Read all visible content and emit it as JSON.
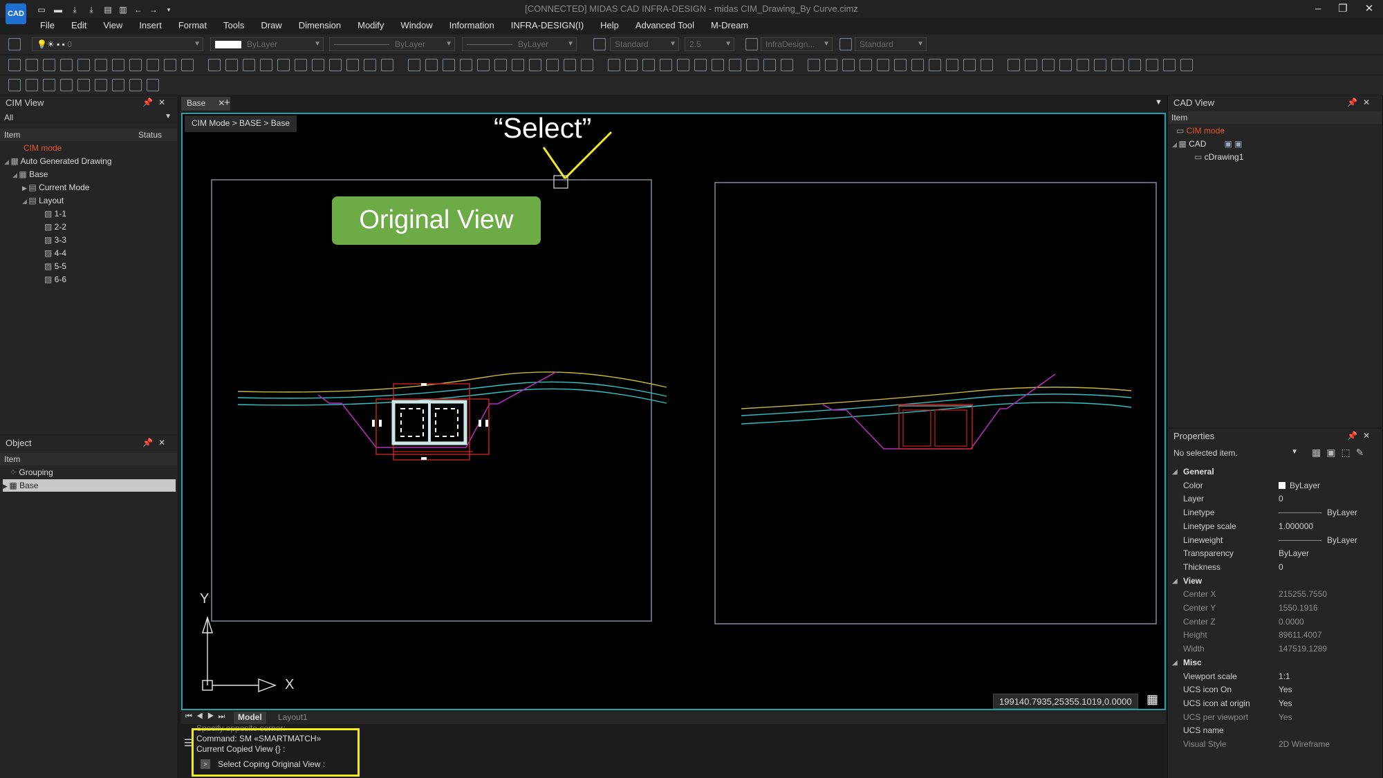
{
  "window": {
    "title": "[CONNECTED] MIDAS CAD INFRA-DESIGN - midas CIM_Drawing_By Curve.cimz",
    "logo": "CAD"
  },
  "menu": [
    "File",
    "Edit",
    "View",
    "Insert",
    "Format",
    "Tools",
    "Draw",
    "Dimension",
    "Modify",
    "Window",
    "Information",
    "INFRA-DESIGN(I)",
    "Help",
    "Advanced Tool",
    "M-Dream"
  ],
  "props_bar": {
    "layer": "0",
    "color": "ByLayer",
    "linetype": "ByLayer",
    "lineweight": "ByLayer",
    "text_style": "Standard",
    "text_height": "2.5",
    "dim_style": "InfraDesign...",
    "table_style": "Standard"
  },
  "cim_view": {
    "title": "CIM View",
    "filter": "All",
    "col_item": "Item",
    "col_status": "Status",
    "rows": [
      "CIM mode",
      "Auto Generated Drawing",
      "Base",
      "Current Mode",
      "Layout",
      "1-1",
      "2-2",
      "3-3",
      "4-4",
      "5-5",
      "6-6"
    ]
  },
  "object_panel": {
    "title": "Object",
    "col_item": "Item",
    "rows": [
      "Grouping",
      "Base"
    ]
  },
  "doc_tab": {
    "label": "Base",
    "plus": "+"
  },
  "breadcrumb": "CIM Mode > BASE > Base",
  "annotation": {
    "select_label": "“Select”",
    "original_view": "Original View"
  },
  "ucs": {
    "y": "Y",
    "x": "X"
  },
  "coords": "199140.7935,25355.1019,0.0000",
  "layout_tabs": [
    "Model",
    "Layout1"
  ],
  "command": {
    "line0": "Specify opposite corner:",
    "line1": "Command:  SM «SMARTMATCH»",
    "line2": "Current Copied View {} :",
    "prompt": "Select Coping Original View :"
  },
  "cad_view": {
    "title": "CAD View",
    "col_item": "Item",
    "rows": [
      "CIM mode",
      "CAD",
      "cDrawing1"
    ]
  },
  "properties": {
    "title": "Properties",
    "selection": "No selected item.",
    "groups": {
      "general": "General",
      "view": "View",
      "misc": "Misc"
    },
    "general": [
      {
        "k": "Color",
        "v": "ByLayer"
      },
      {
        "k": "Layer",
        "v": "0"
      },
      {
        "k": "Linetype",
        "v": "ByLayer"
      },
      {
        "k": "Linetype scale",
        "v": "1.000000"
      },
      {
        "k": "Lineweight",
        "v": "ByLayer"
      },
      {
        "k": "Transparency",
        "v": "ByLayer"
      },
      {
        "k": "Thickness",
        "v": "0"
      }
    ],
    "view": [
      {
        "k": "Center X",
        "v": "215255.7550"
      },
      {
        "k": "Center Y",
        "v": "1550.1916"
      },
      {
        "k": "Center Z",
        "v": "0.0000"
      },
      {
        "k": "Height",
        "v": "89611.4007"
      },
      {
        "k": "Width",
        "v": "147519.1289"
      }
    ],
    "misc": [
      {
        "k": "Viewport scale",
        "v": "1:1"
      },
      {
        "k": "UCS icon On",
        "v": "Yes"
      },
      {
        "k": "UCS icon at origin",
        "v": "Yes"
      },
      {
        "k": "UCS per viewport",
        "v": "Yes"
      },
      {
        "k": "UCS name",
        "v": ""
      },
      {
        "k": "Visual Style",
        "v": "2D Wireframe"
      }
    ]
  },
  "colors": {
    "accent": "#1aa3b0",
    "cim_mode": "#e8532c",
    "green_button": "#6cab45",
    "highlight": "#f2ec1a"
  }
}
